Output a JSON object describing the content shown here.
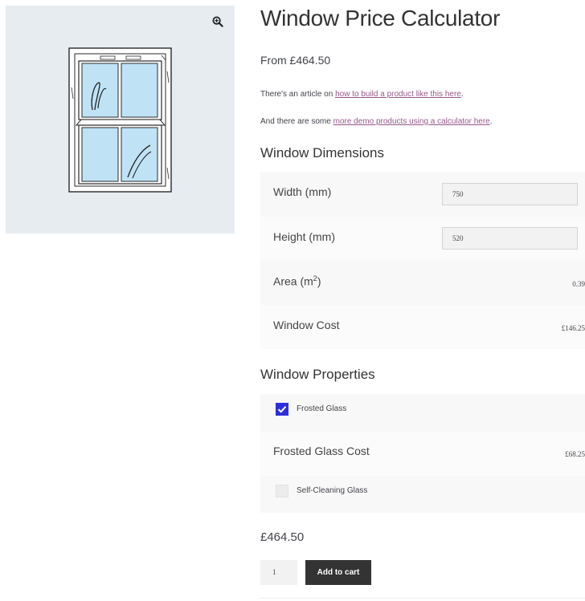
{
  "product": {
    "title": "Window Price Calculator",
    "price_from": "From £464.50",
    "note1_prefix": "There's an article on ",
    "note1_link": "how to build a product like this here",
    "note1_suffix": ".",
    "note2_prefix": "And there are some ",
    "note2_link": "more demo products using a calculator here",
    "note2_suffix": "."
  },
  "dimensions": {
    "heading": "Window Dimensions",
    "width_label": "Width (mm)",
    "width_value": "750",
    "height_label": "Height (mm)",
    "height_value": "520",
    "area_label": "Area (m",
    "area_sup": "2",
    "area_label_end": ")",
    "area_value": "0.39",
    "cost_label": "Window Cost",
    "cost_value": "£146.25"
  },
  "properties": {
    "heading": "Window Properties",
    "frosted_label": "Frosted Glass",
    "frosted_checked": true,
    "frosted_cost_label": "Frosted Glass Cost",
    "frosted_cost_value": "£68.25",
    "selfclean_label": "Self-Cleaning Glass",
    "selfclean_checked": false
  },
  "cart": {
    "total": "£464.50",
    "quantity": "1",
    "add_label": "Add to cart"
  },
  "colors": {
    "accent_checkbox": "#2c2fdd",
    "link": "#96588a",
    "button": "#333333"
  },
  "icons": {
    "zoom": "zoom-in-icon",
    "check": "checkmark-icon"
  }
}
